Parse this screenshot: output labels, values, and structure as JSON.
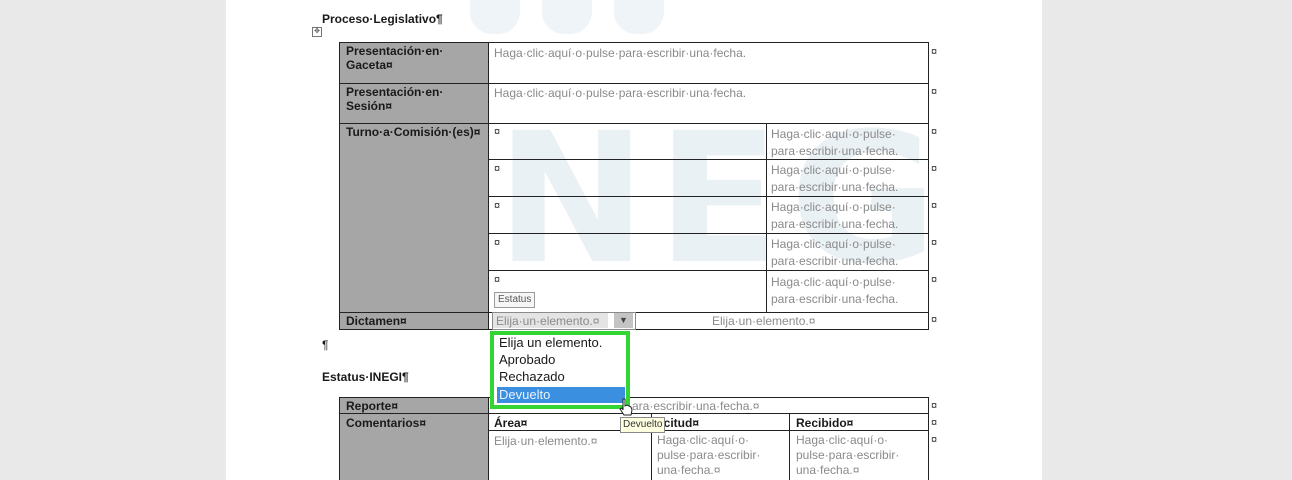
{
  "document": {
    "heading": "Proceso·Legislativo¶",
    "anchor_icon": "move-anchor-icon",
    "placeholder_fecha": "Haga·clic·aquí·o·pulse·para·escribir·una·fecha.",
    "placeholder_fecha_line1": "Haga·clic·aquí·o·pulse·",
    "placeholder_fecha_line2": "para·escribir·una·fecha.",
    "cell_mark": "¤",
    "row_mark": "¤",
    "label_presentacion_gaceta_1": "Presentación·en·",
    "label_presentacion_gaceta_2": "Gaceta¤",
    "label_presentacion_sesion_1": "Presentación·en·",
    "label_presentacion_sesion_2": "Sesión¤",
    "label_turno": "Turno·a·Comisión·(es)¤",
    "label_dictamen": "Dictamen¤",
    "estatus_tag": "Estatus",
    "dictamen_value": "Elija·un·elemento.¤",
    "dictamen_value_2": "Elija·un·elemento.¤",
    "pilcrow": "¶",
    "estatus_inegi": "Estatus·INEGI¶",
    "label_reporte": "Reporte¤",
    "reporte_placeholder": "ara·escribir·una·fecha.¤",
    "label_comentarios": "Comentarios¤",
    "col_area": "Área¤",
    "col_solicitud": "licitud¤",
    "col_recibido": "Recibido¤",
    "area_value": "Elija·un·elemento.¤",
    "fecha_small_1": "Haga·clic·aquí·o·",
    "fecha_small_2": "pulse·para·escribir·",
    "fecha_small_3": "una·fecha.¤"
  },
  "dropdown": {
    "options": [
      "Elija un elemento.",
      "Aprobado",
      "Rechazado",
      "Devuelto"
    ],
    "selected": "Devuelto",
    "border_color": "#35d435",
    "highlight_color": "#3b8fe0"
  },
  "tooltip": {
    "text": "Devuelto"
  },
  "icons": {
    "cursor": "hand-cursor-icon",
    "dropdown_arrow": "chevron-down-icon"
  }
}
